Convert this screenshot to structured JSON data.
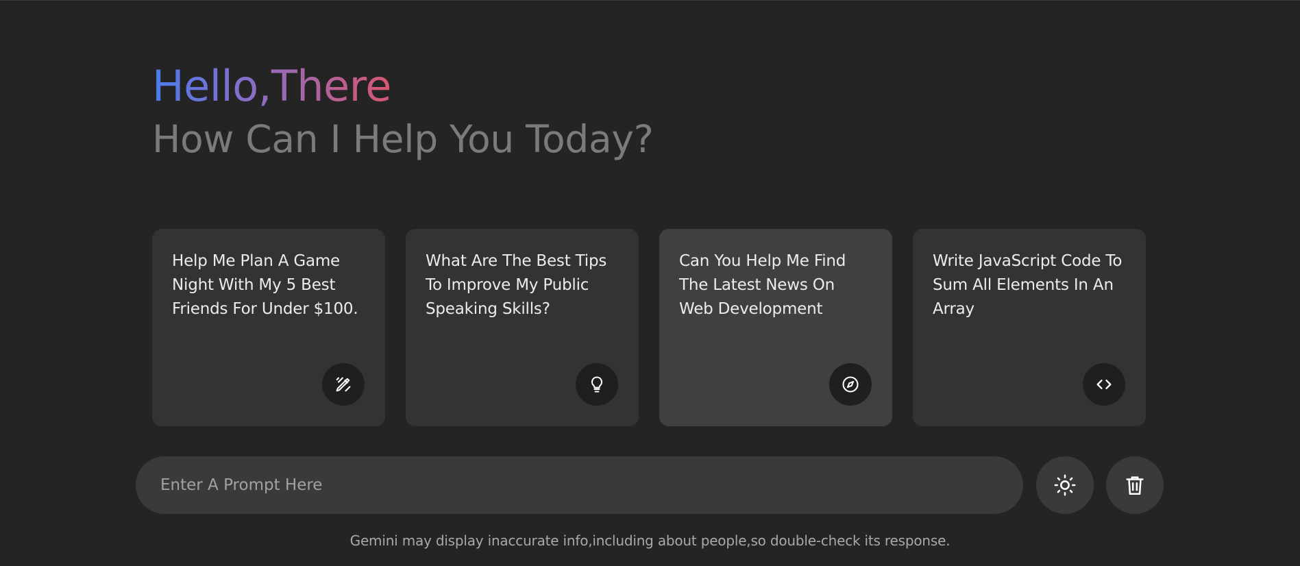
{
  "header": {
    "greeting": "Hello,There",
    "subtitle": "How Can I Help You Today?"
  },
  "suggestions": [
    {
      "text": "Help Me Plan A Game Night With My 5 Best Friends For Under $100.",
      "icon": "magic-pen-icon"
    },
    {
      "text": "What Are The Best Tips To Improve My Public Speaking Skills?",
      "icon": "lightbulb-icon"
    },
    {
      "text": "Can You Help Me Find The Latest News On Web Development",
      "icon": "compass-icon"
    },
    {
      "text": "Write JavaScript Code To Sum All Elements In An Array",
      "icon": "code-icon"
    }
  ],
  "prompt": {
    "placeholder": "Enter A Prompt Here",
    "value": ""
  },
  "actions": {
    "theme_icon": "sun-icon",
    "delete_icon": "trash-icon"
  },
  "footer": {
    "disclaimer": "Gemini may display inaccurate info,including about people,so double-check its response."
  },
  "colors": {
    "background": "#242424",
    "card": "#333333",
    "card_hover": "#404040",
    "gradient_start": "#4b7bec",
    "gradient_end": "#d9566f",
    "subtitle": "#7b7b7b"
  }
}
